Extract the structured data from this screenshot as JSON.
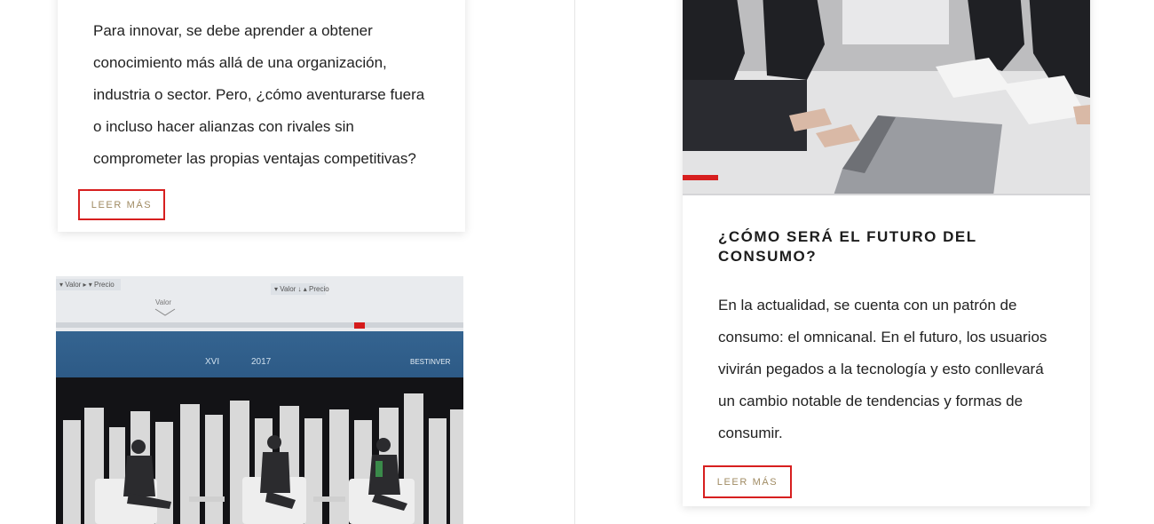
{
  "cards": {
    "top_left": {
      "excerpt": "Para innovar, se debe aprender a obtener conocimiento más allá de una organización, industria o sector. Pero, ¿cómo aventurarse fuera o incluso hacer alianzas con rivales sin comprometer las propias ventajas competitivas?",
      "read_more": "LEER MÁS"
    },
    "right": {
      "title": "¿CÓMO SERÁ EL FUTURO DEL CONSUMO?",
      "excerpt": "En la actualidad, se cuenta con un patrón de consumo: el omnicanal. En el futuro, los usuarios vivirán pegados a la tecnología y esto conllevará un cambio notable de tendencias y formas de consumir.",
      "read_more": "LEER MÁS"
    },
    "bottom_left": {
      "image": "conference-stage-photo"
    }
  },
  "conference_photo": {
    "screen_left_label": "▾ Valor ▸ ▾ Precio",
    "screen_right_label": "▾ Valor ↓ ▴ Precio",
    "screen_center_label": "Valor",
    "event_label": "XVI",
    "year_label": "2017",
    "brand_label": "BESTINVER"
  },
  "meeting_photo": {
    "image": "business-meeting-photo"
  },
  "colors": {
    "read_more_border": "#d71f1f",
    "read_more_text": "#a08b63",
    "title_text": "#1c1c1c",
    "body_text": "#222222"
  }
}
